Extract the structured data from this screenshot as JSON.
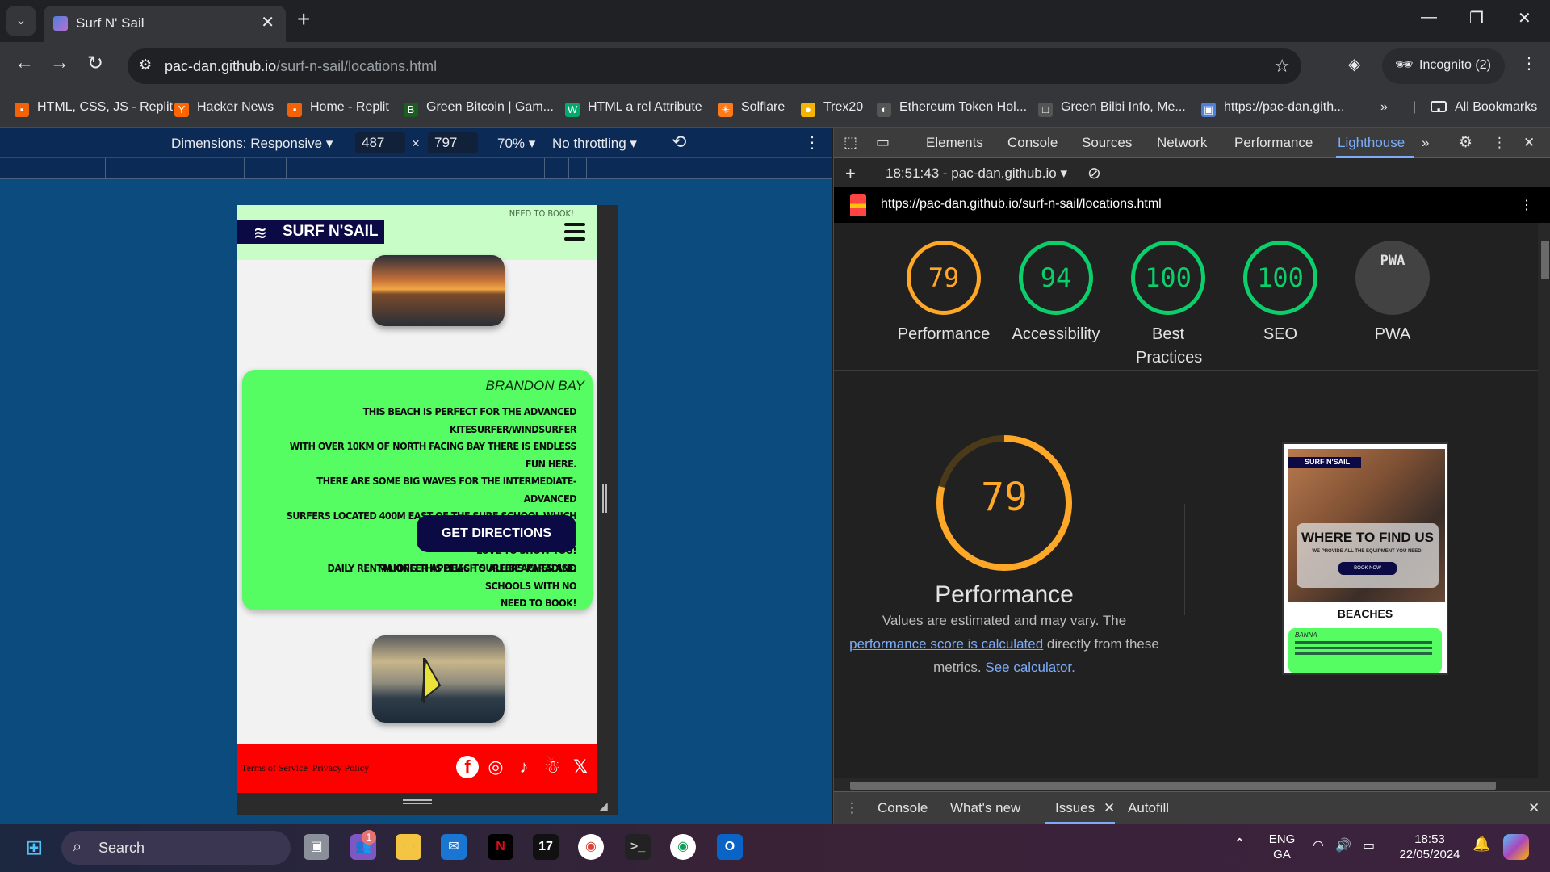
{
  "browser": {
    "tab_title": "Surf N' Sail",
    "url_host": "pac-dan.github.io",
    "url_path": "/surf-n-sail/locations.html",
    "incognito_label": "Incognito (2)",
    "bookmarks": [
      {
        "label": "HTML, CSS, JS - Replit",
        "color": "#f26207"
      },
      {
        "label": "Hacker News",
        "color": "#ff6600",
        "glyph": "Y"
      },
      {
        "label": "Home - Replit",
        "color": "#f26207"
      },
      {
        "label": "Green Bitcoin | Gam...",
        "color": "#1b5e20",
        "glyph": "B"
      },
      {
        "label": "HTML a rel Attribute",
        "color": "#04aa6d",
        "glyph": "W"
      },
      {
        "label": "Solflare",
        "color": "#fc7a1a",
        "glyph": "✳"
      },
      {
        "label": "Trex20",
        "color": "#f5b400",
        "glyph": "●"
      },
      {
        "label": "Ethereum Token Hol...",
        "color": "#555555",
        "glyph": "◐"
      },
      {
        "label": "Green Bilbi Info, Me...",
        "color": "#555555",
        "glyph": "□"
      },
      {
        "label": "https://pac-dan.gith...",
        "color": "#4e7fd9",
        "glyph": "▣"
      }
    ],
    "all_bookmarks": "All Bookmarks"
  },
  "device_toolbar": {
    "dimensions_label": "Dimensions: Responsive",
    "width": "487",
    "height": "797",
    "times": "×",
    "zoom": "70%",
    "throttling": "No throttling"
  },
  "site": {
    "need_to_book": "NEED TO BOOK!",
    "logo_text": "SURF N'SAIL",
    "card_title": "BRANDON BAY",
    "card_lines": [
      "THIS BEACH IS PERFECT FOR THE ADVANCED KITESURFER/WINDSURFER",
      "WITH OVER 10KM OF NORTH FACING BAY THERE IS ENDLESS FUN HERE.",
      "THERE ARE SOME BIG WAVES FOR THE INTERMEDIATE-ADVANCED",
      "SURFERS LOCATED 400M EAST OF THE SURF SCHOOL WHICH WE WOULD",
      "LOVE TO SHOW YOU!",
      "MAKING THIS BEACH SURFERS PARADISE."
    ],
    "directions_button": "GET DIRECTIONS",
    "rental_lines": [
      "DAILY RENTAL OFFER APPLIES TO ALL BEACHES AND SCHOOLS WITH NO",
      "NEED TO BOOK!"
    ],
    "footer_terms": "Terms of Service",
    "footer_privacy": "Privacy Policy"
  },
  "devtools": {
    "tabs": [
      "Elements",
      "Console",
      "Sources",
      "Network",
      "Performance",
      "Lighthouse"
    ],
    "active_tab": "Lighthouse",
    "report_selector": "18:51:43 - pac-dan.github.io",
    "report_url": "https://pac-dan.github.io/surf-n-sail/locations.html",
    "scores": [
      {
        "label": "Performance",
        "value": "79",
        "color": "#ffa726"
      },
      {
        "label": "Accessibility",
        "value": "94",
        "color": "#0cce6b"
      },
      {
        "label": "Best Practices",
        "value": "100",
        "color": "#0cce6b"
      },
      {
        "label": "SEO",
        "value": "100",
        "color": "#0cce6b"
      },
      {
        "label": "PWA",
        "value": "PWA",
        "color": "#9e9e9e"
      }
    ],
    "big_score": "79",
    "big_score_fraction": 0.79,
    "perf_title": "Performance",
    "perf_desc_1": "Values are estimated and may vary. The",
    "perf_link_1": "performance score is calculated",
    "perf_desc_2": "directly from these metrics.",
    "perf_link_2": "See calculator.",
    "thumb": {
      "logo": "SURF N'SAIL",
      "title": "WHERE TO FIND US",
      "subtitle": "WE PROVIDE ALL THE EQUIPMENT YOU NEED!",
      "button": "BOOK NOW",
      "beaches": "BEACHES",
      "card": "BANNA"
    },
    "drawer_tabs": [
      "Console",
      "What's new",
      "Issues",
      "Autofill"
    ]
  },
  "taskbar": {
    "search": "Search",
    "lang_1": "ENG",
    "lang_2": "GA",
    "time": "18:53",
    "date": "22/05/2024",
    "badge": "1"
  }
}
